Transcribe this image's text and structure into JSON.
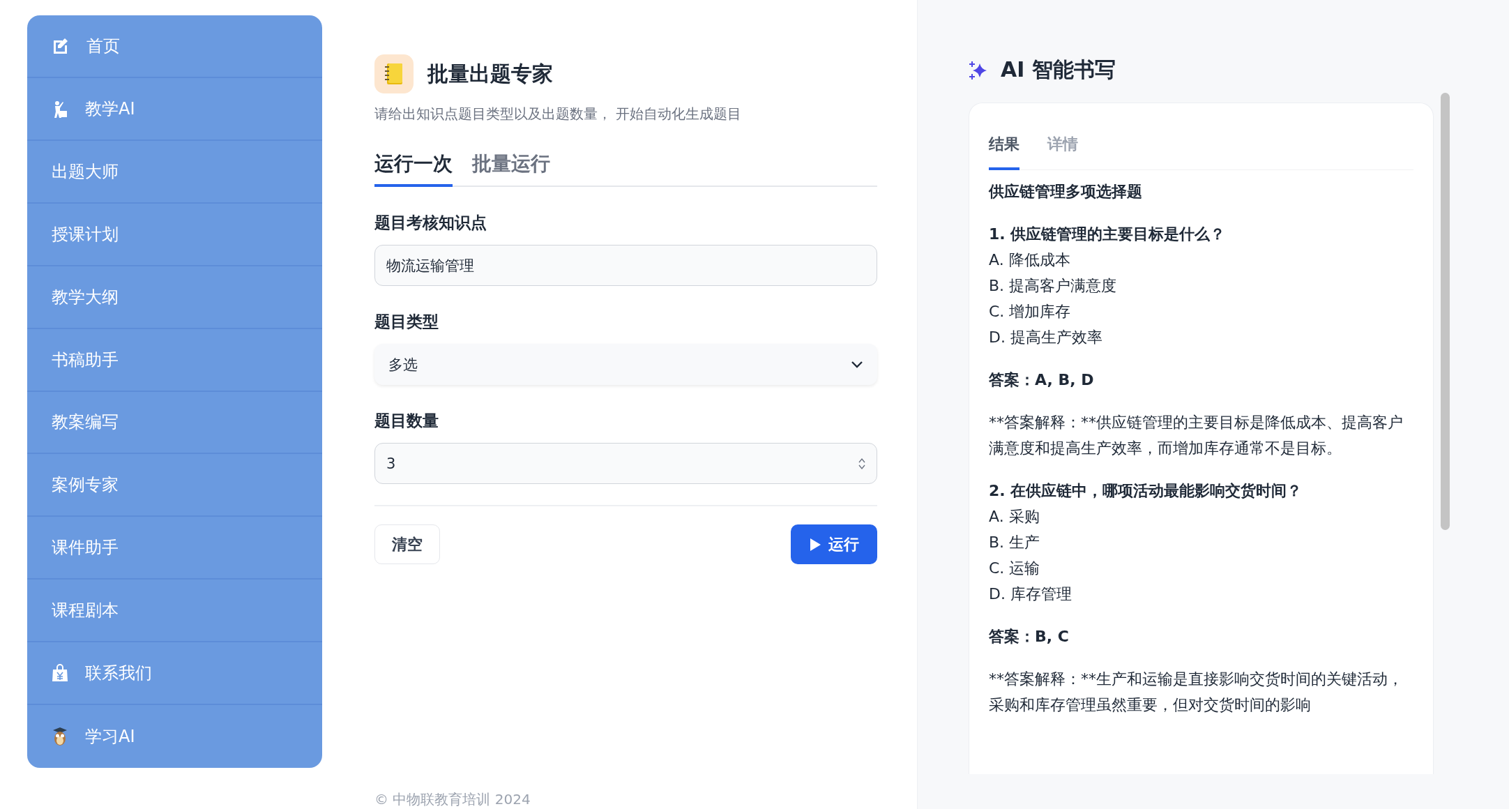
{
  "sidebar": {
    "items": [
      {
        "label": "首页"
      },
      {
        "label": "教学AI"
      },
      {
        "label": "出题大师"
      },
      {
        "label": "授课计划"
      },
      {
        "label": "教学大纲"
      },
      {
        "label": "书稿助手"
      },
      {
        "label": "教案编写"
      },
      {
        "label": "案例专家"
      },
      {
        "label": "课件助手"
      },
      {
        "label": "课程剧本"
      },
      {
        "label": "联系我们"
      },
      {
        "label": "学习AI"
      }
    ]
  },
  "main": {
    "title": "批量出题专家",
    "subtitle": "请给出知识点题目类型以及出题数量， 开始自动化生成题目",
    "tabs": [
      {
        "label": "运行一次",
        "selected": true
      },
      {
        "label": "批量运行",
        "selected": false
      }
    ],
    "fields": [
      {
        "kind": "text",
        "label": "题目考核知识点",
        "value": "物流运输管理"
      },
      {
        "kind": "select",
        "label": "题目类型",
        "value": "多选"
      },
      {
        "kind": "number",
        "label": "题目数量",
        "value": "3"
      }
    ],
    "clear_button": "清空",
    "run_button": "运行",
    "footer": "© 中物联教育培训 2024"
  },
  "result": {
    "title": "AI 智能书写",
    "tabs": [
      {
        "label": "结果",
        "selected": true
      },
      {
        "label": "详情",
        "selected": false
      }
    ],
    "blocks": [
      {
        "kind": "heading",
        "text": "供应链管理多项选择题"
      },
      {
        "kind": "question",
        "text": "1. 供应链管理的主要目标是什么？"
      },
      {
        "kind": "option",
        "text": "A. 降低成本"
      },
      {
        "kind": "option",
        "text": "B. 提高客户满意度"
      },
      {
        "kind": "option",
        "text": "C. 增加库存"
      },
      {
        "kind": "option",
        "text": "D. 提高生产效率"
      },
      {
        "kind": "answer",
        "text": "答案：A, B, D"
      },
      {
        "kind": "explanation",
        "text": "**答案解释：**供应链管理的主要目标是降低成本、提高客户满意度和提高生产效率，而增加库存通常不是目标。"
      },
      {
        "kind": "question",
        "text": "2. 在供应链中，哪项活动最能影响交货时间？"
      },
      {
        "kind": "option",
        "text": "A. 采购"
      },
      {
        "kind": "option",
        "text": "B. 生产"
      },
      {
        "kind": "option",
        "text": "C. 运输"
      },
      {
        "kind": "option",
        "text": "D. 库存管理"
      },
      {
        "kind": "answer",
        "text": "答案：B, C"
      },
      {
        "kind": "explanation",
        "text": "**答案解释：**生产和运输是直接影响交货时间的关键活动，采购和库存管理虽然重要，但对交货时间的影响"
      }
    ]
  }
}
